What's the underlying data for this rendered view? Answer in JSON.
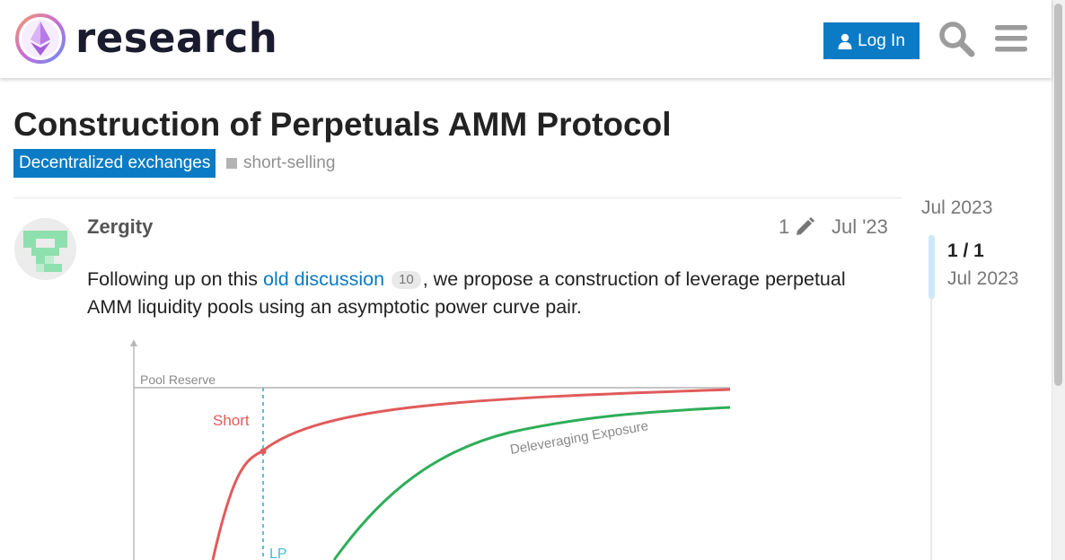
{
  "header": {
    "brand": "research",
    "login_label": "Log In",
    "icons": [
      "logo-icon",
      "user-icon",
      "search-icon",
      "menu-icon"
    ]
  },
  "topic": {
    "title": "Construction of Perpetuals AMM Protocol",
    "category": "Decentralized exchanges",
    "tag": "short-selling"
  },
  "post": {
    "username": "Zergity",
    "edit_count": "1",
    "date": "Jul '23",
    "body_before_link": "Following up on this ",
    "link_text": "old discussion",
    "link_clicks": "10",
    "body_after_link": ", we propose a construction of leverage perpetual AMM liquidity pools using an asymptotic power curve pair."
  },
  "timeline": {
    "top_date": "Jul 2023",
    "position": "1 / 1",
    "bottom_date": "Jul 2023"
  },
  "chart_labels": {
    "pool_reserve": "Pool Reserve",
    "short": "Short",
    "deleveraging": "Deleveraging Exposure",
    "lp": "LP"
  },
  "colors": {
    "accent": "#0a7bc4",
    "short_curve": "#e15b5b",
    "deleverage_curve": "#2fae5a",
    "lp_line": "#4ab8e0"
  }
}
